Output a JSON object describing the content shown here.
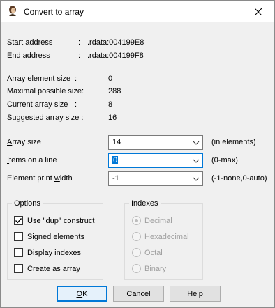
{
  "window": {
    "title": "Convert to array"
  },
  "info": {
    "start_address_label": "Start address",
    "start_address_sep": ":",
    "start_address_value": ".rdata:004199E8",
    "end_address_label": "End address",
    "end_address_sep": ":",
    "end_address_value": ".rdata:004199F8",
    "element_size_label": "Array element size",
    "element_size_sep": ":",
    "element_size_value": "0",
    "max_size_label": "Maximal possible size:",
    "max_size_value": "288",
    "current_size_label": "Current array size",
    "current_size_sep": ":",
    "current_size_value": "8",
    "suggested_size_label": "Suggested array size :",
    "suggested_size_value": "16"
  },
  "fields": {
    "array_size": {
      "label_ul": "A",
      "label_rest": "rray size",
      "value": "14",
      "hint": "(in elements)"
    },
    "items_per_line": {
      "label_ul": "I",
      "label_rest": "tems on a line",
      "value": "0",
      "hint": "(0-max)"
    },
    "print_width": {
      "label_pre": "Element print ",
      "label_ul": "w",
      "label_rest": "idth",
      "value": "-1",
      "hint": "(-1-none,0-auto)"
    }
  },
  "options": {
    "title": "Options",
    "items": [
      {
        "pre": "Use \"",
        "ul": "d",
        "post": "up\" construct",
        "checked": true
      },
      {
        "pre": "S",
        "ul": "i",
        "post": "gned elements",
        "checked": false
      },
      {
        "pre": "Displa",
        "ul": "y",
        "post": " indexes",
        "checked": false
      },
      {
        "pre": "Create as a",
        "ul": "r",
        "post": "ray",
        "checked": false
      }
    ]
  },
  "indexes": {
    "title": "Indexes",
    "items": [
      {
        "ul": "D",
        "post": "ecimal",
        "selected": true
      },
      {
        "ul": "H",
        "post": "exadecimal",
        "selected": false
      },
      {
        "ul": "O",
        "post": "ctal",
        "selected": false
      },
      {
        "ul": "B",
        "post": "inary",
        "selected": false
      }
    ]
  },
  "buttons": {
    "ok_ul": "O",
    "ok_rest": "K",
    "cancel": "Cancel",
    "help": "Help"
  }
}
